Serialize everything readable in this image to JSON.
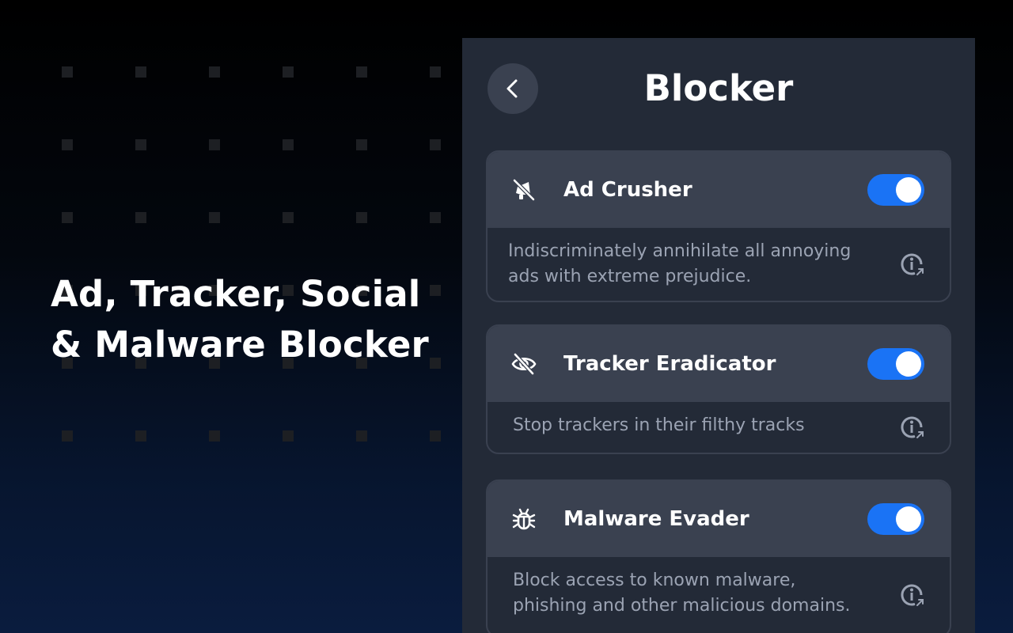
{
  "hero": {
    "headline_line1": "Ad, Tracker, Social",
    "headline_line2": "& Malware Blocker"
  },
  "panel": {
    "title": "Blocker",
    "back_icon": "chevron-left-icon"
  },
  "features": [
    {
      "title": "Ad Crusher",
      "description": "Indiscriminately annihilate all annoying ads with extreme prejudice.",
      "icon": "crossed-megaphone-icon",
      "enabled": true
    },
    {
      "title": "Tracker Eradicator",
      "description": "Stop trackers in their filthy tracks",
      "icon": "eye-off-icon",
      "enabled": true
    },
    {
      "title": "Malware Evader",
      "description": "Block access to known malware, phishing and other malicious domains.",
      "icon": "bug-icon",
      "enabled": true
    }
  ],
  "colors": {
    "panel_background": "#232a37",
    "card_header": "#3a4150",
    "toggle_on": "#1a73f5",
    "description_text": "#9ba3b3"
  }
}
